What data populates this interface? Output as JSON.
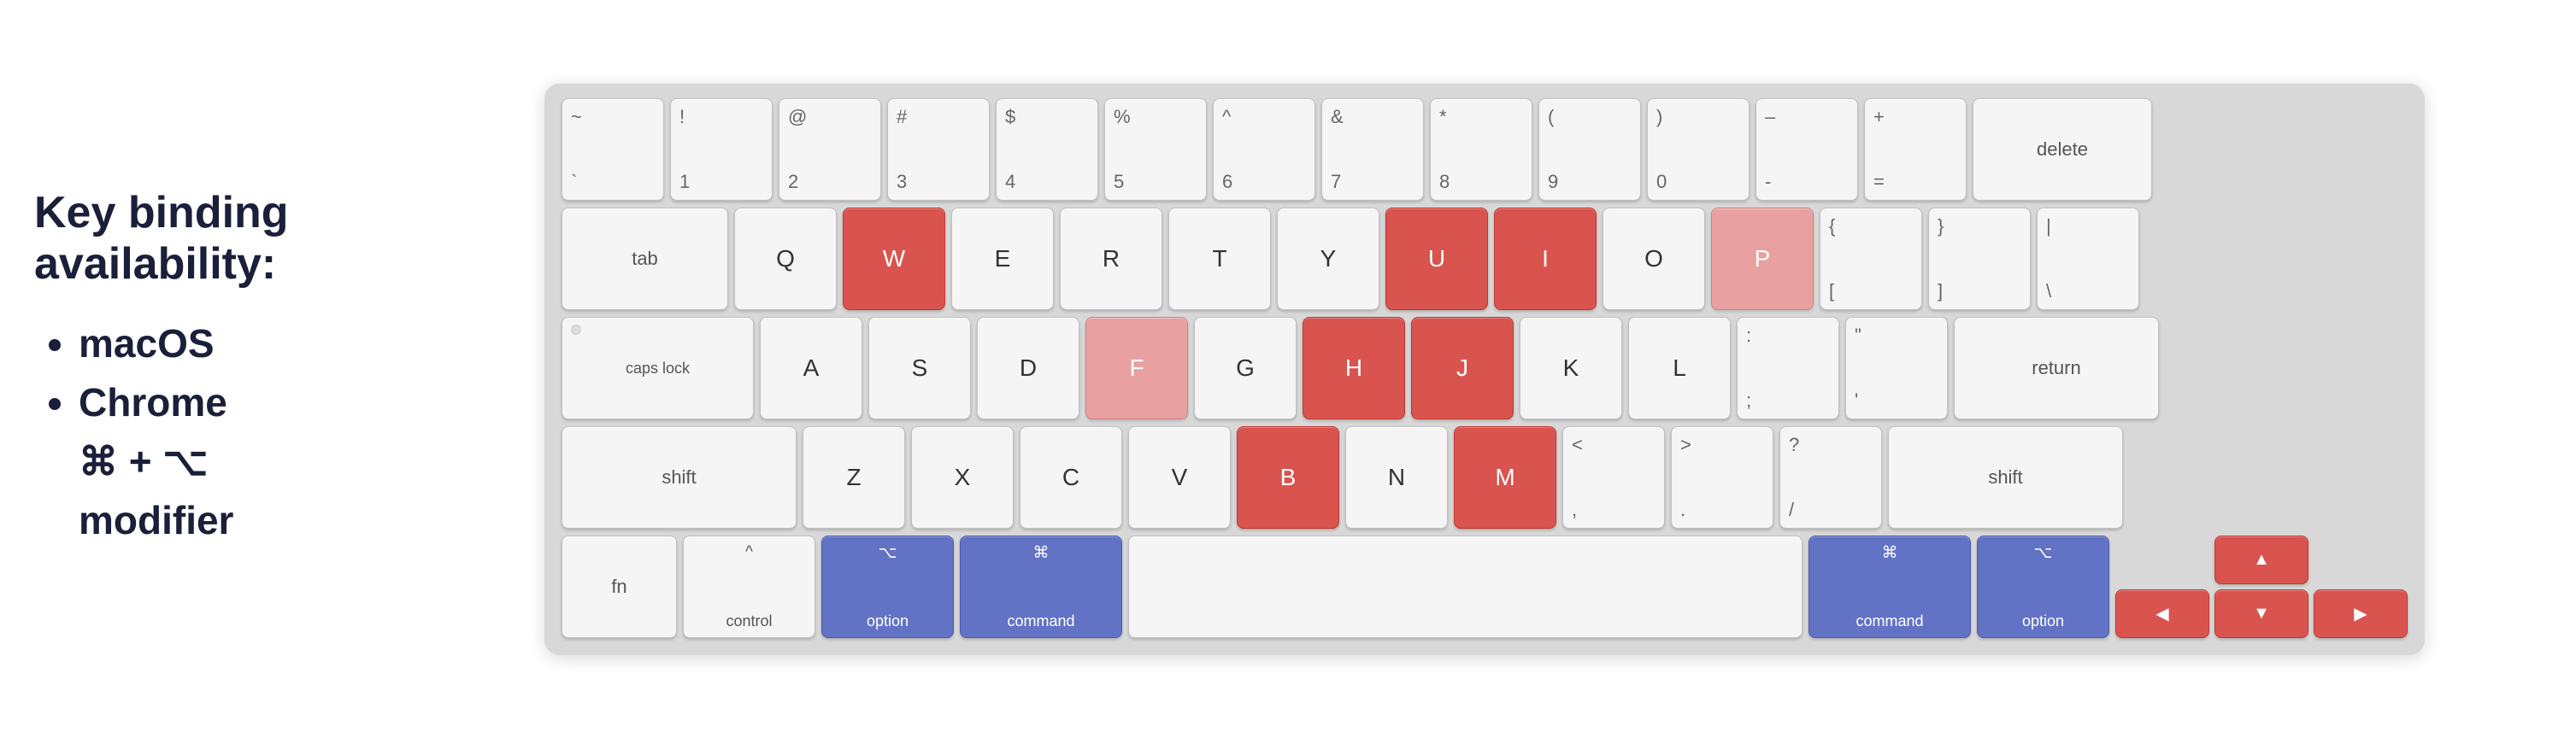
{
  "left": {
    "title": "Key binding\navailability:",
    "items": [
      "macOS",
      "Chrome",
      "⌘ + ⌥ modifier"
    ]
  },
  "keyboard": {
    "row1": [
      {
        "label": "~\n`",
        "id": "tilde"
      },
      {
        "label": "!\n1",
        "id": "1"
      },
      {
        "label": "@\n2",
        "id": "2"
      },
      {
        "label": "#\n3",
        "id": "3"
      },
      {
        "label": "$\n4",
        "id": "4"
      },
      {
        "label": "%\n5",
        "id": "5"
      },
      {
        "label": "^\n6",
        "id": "6"
      },
      {
        "label": "&\n7",
        "id": "7"
      },
      {
        "label": "*\n8",
        "id": "8"
      },
      {
        "label": "(\n9",
        "id": "9"
      },
      {
        "label": ")\n0",
        "id": "0"
      },
      {
        "label": "_\n-",
        "id": "minus"
      },
      {
        "label": "+\n=",
        "id": "equals"
      },
      {
        "label": "delete",
        "id": "delete"
      }
    ],
    "row2": [
      {
        "label": "tab",
        "id": "tab"
      },
      {
        "label": "Q",
        "id": "q"
      },
      {
        "label": "W",
        "id": "w",
        "color": "red"
      },
      {
        "label": "E",
        "id": "e"
      },
      {
        "label": "R",
        "id": "r"
      },
      {
        "label": "T",
        "id": "t"
      },
      {
        "label": "Y",
        "id": "y"
      },
      {
        "label": "U",
        "id": "u",
        "color": "red"
      },
      {
        "label": "I",
        "id": "i",
        "color": "red"
      },
      {
        "label": "O",
        "id": "o"
      },
      {
        "label": "P",
        "id": "p",
        "color": "red-light"
      },
      {
        "label": "{\n[",
        "id": "bracket-l"
      },
      {
        "label": "}\n]",
        "id": "bracket-r"
      },
      {
        "label": "|\n\\",
        "id": "backslash"
      }
    ],
    "row3": [
      {
        "label": "caps lock",
        "id": "caps"
      },
      {
        "label": "A",
        "id": "a"
      },
      {
        "label": "S",
        "id": "s"
      },
      {
        "label": "D",
        "id": "d"
      },
      {
        "label": "F",
        "id": "f",
        "color": "red-light"
      },
      {
        "label": "G",
        "id": "g"
      },
      {
        "label": "H",
        "id": "h",
        "color": "red"
      },
      {
        "label": "J",
        "id": "j",
        "color": "red"
      },
      {
        "label": "K",
        "id": "k"
      },
      {
        "label": "L",
        "id": "l"
      },
      {
        "label": ":\n;",
        "id": "semicolon"
      },
      {
        "label": "\"\n'",
        "id": "quote"
      },
      {
        "label": "return",
        "id": "return"
      }
    ],
    "row4": [
      {
        "label": "shift",
        "id": "shift-l"
      },
      {
        "label": "Z",
        "id": "z"
      },
      {
        "label": "X",
        "id": "x"
      },
      {
        "label": "C",
        "id": "c"
      },
      {
        "label": "V",
        "id": "v"
      },
      {
        "label": "B",
        "id": "b",
        "color": "red"
      },
      {
        "label": "N",
        "id": "n"
      },
      {
        "label": "M",
        "id": "m",
        "color": "red"
      },
      {
        "label": "<\n,",
        "id": "comma"
      },
      {
        "label": ">\n.",
        "id": "period"
      },
      {
        "label": "?\n/",
        "id": "slash"
      },
      {
        "label": "shift",
        "id": "shift-r"
      }
    ],
    "row5": [
      {
        "label": "fn",
        "id": "fn"
      },
      {
        "label": "^\ncontrol",
        "id": "control"
      },
      {
        "label": "⌥\noption",
        "id": "option-l",
        "color": "blue"
      },
      {
        "label": "⌘\ncommand",
        "id": "command-l",
        "color": "blue"
      },
      {
        "label": "",
        "id": "space"
      },
      {
        "label": "⌘\ncommand",
        "id": "command-r",
        "color": "blue"
      },
      {
        "label": "⌥\noption",
        "id": "option-r",
        "color": "blue"
      },
      {
        "label": "▲",
        "id": "arrow-up",
        "color": "red"
      },
      {
        "label": "◀",
        "id": "arrow-left",
        "color": "red"
      },
      {
        "label": "▼",
        "id": "arrow-down",
        "color": "red"
      },
      {
        "label": "▶",
        "id": "arrow-right",
        "color": "red"
      }
    ]
  }
}
